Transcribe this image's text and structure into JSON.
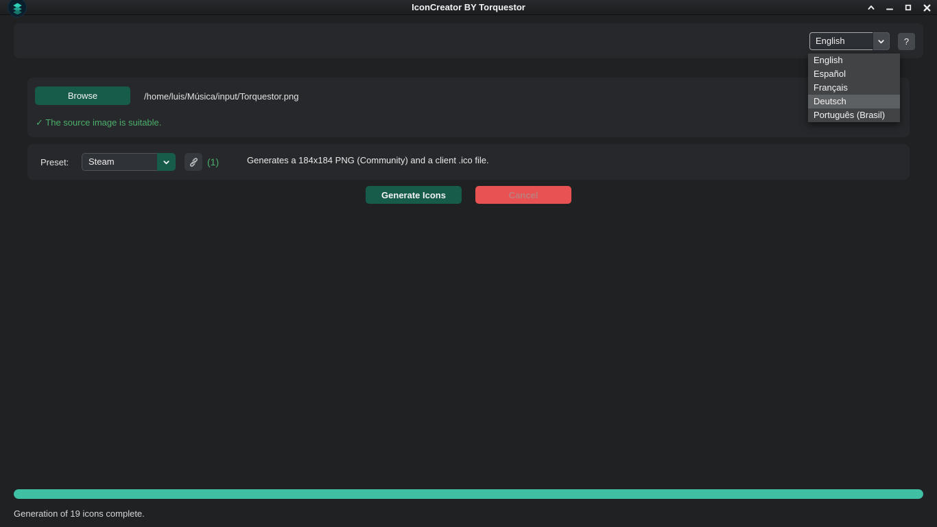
{
  "window": {
    "title": "IconCreator BY Torquestor"
  },
  "toolbar": {
    "language_select": {
      "value": "English"
    },
    "help_label": "?"
  },
  "language_menu": {
    "items": [
      {
        "label": "English",
        "highlighted": false
      },
      {
        "label": "Español",
        "highlighted": false
      },
      {
        "label": "Français",
        "highlighted": false
      },
      {
        "label": "Deutsch",
        "highlighted": true
      },
      {
        "label": "Português (Brasil)",
        "highlighted": false
      }
    ]
  },
  "source": {
    "browse_label": "Browse",
    "path": "/home/luis/Música/input/Torquestor.png",
    "status_icon": "✓",
    "status_message": "The source image is suitable."
  },
  "preset": {
    "label": "Preset:",
    "value": "Steam",
    "count": "(1)",
    "description": "Generates a 184x184 PNG (Community) and a client .ico file."
  },
  "actions": {
    "generate_label": "Generate Icons",
    "cancel_label": "Cancel"
  },
  "progress": {
    "percent": 100,
    "status_text": "Generation of 19 icons complete."
  },
  "colors": {
    "accent_green": "#175c4b",
    "progress_teal": "#3fc0a4",
    "cancel_red": "#e85252",
    "success_green": "#4caf6b",
    "panel_bg": "#26282b",
    "window_bg": "#1f2123"
  }
}
